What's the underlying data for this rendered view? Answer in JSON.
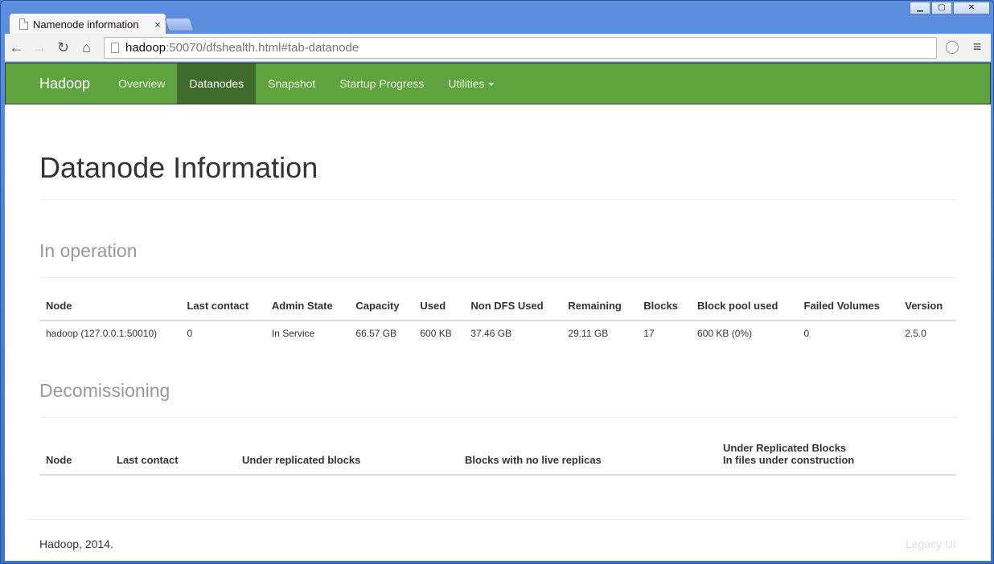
{
  "browser": {
    "tab_title": "Namenode information",
    "tab_close": "×",
    "url_host": "hadoop",
    "url_rest": ":50070/dfshealth.html#tab-datanode",
    "window_buttons": {
      "minimize": "▁",
      "maximize": "▢",
      "close": "✕"
    }
  },
  "navbar": {
    "brand": "Hadoop",
    "items": [
      {
        "label": "Overview",
        "active": false
      },
      {
        "label": "Datanodes",
        "active": true
      },
      {
        "label": "Snapshot",
        "active": false
      },
      {
        "label": "Startup Progress",
        "active": false
      },
      {
        "label": "Utilities",
        "active": false
      }
    ],
    "color": "#5fa33e",
    "active_color": "#3f6b2c"
  },
  "page": {
    "title": "Datanode Information",
    "in_operation": {
      "heading": "In operation",
      "columns": [
        "Node",
        "Last contact",
        "Admin State",
        "Capacity",
        "Used",
        "Non DFS Used",
        "Remaining",
        "Blocks",
        "Block pool used",
        "Failed Volumes",
        "Version"
      ],
      "rows": [
        [
          "hadoop (127.0.0.1:50010)",
          "0",
          "In Service",
          "66.57 GB",
          "600 KB",
          "37.46 GB",
          "29.11 GB",
          "17",
          "600 KB (0%)",
          "0",
          "2.5.0"
        ]
      ]
    },
    "decommissioning": {
      "heading": "Decomissioning",
      "columns": [
        "Node",
        "Last contact",
        "Under replicated blocks",
        "Blocks with no live replicas"
      ],
      "last_column_line1": "Under Replicated Blocks",
      "last_column_line2": "In files under construction"
    }
  },
  "footer": {
    "copyright": "Hadoop, 2014.",
    "legacy_link": "Legacy UI"
  }
}
